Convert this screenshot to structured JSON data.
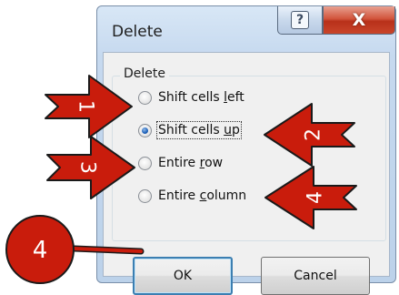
{
  "dialog": {
    "title": "Delete",
    "help_glyph": "?",
    "close_glyph": "X",
    "group_label": "Delete",
    "options": [
      {
        "pre": "Shift cells ",
        "key": "l",
        "post": "eft",
        "selected": false
      },
      {
        "pre": "Shift cells ",
        "key": "u",
        "post": "p",
        "selected": true
      },
      {
        "pre": "Entire ",
        "key": "r",
        "post": "ow",
        "selected": false
      },
      {
        "pre": "Entire ",
        "key": "c",
        "post": "olumn",
        "selected": false
      }
    ],
    "ok_label": "OK",
    "cancel_label": "Cancel"
  },
  "annotations": {
    "arrow_1": "1",
    "arrow_2": "2",
    "arrow_3": "3",
    "arrow_4": "4",
    "circle_4": "4"
  },
  "colors": {
    "annotation_red": "#c91c0c",
    "annotation_outline": "#1a1a1a",
    "radio_selected": "#1b5fb8"
  }
}
